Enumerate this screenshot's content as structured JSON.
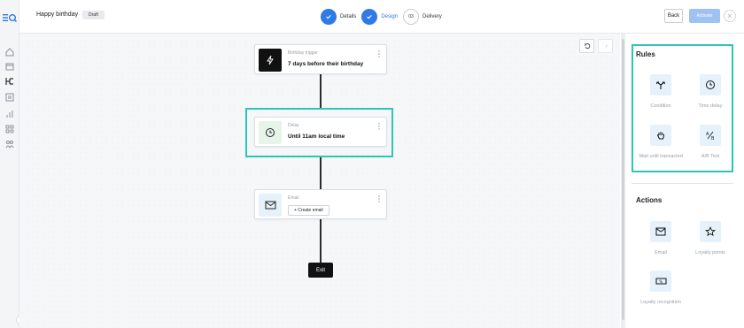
{
  "header": {
    "campaign_title": "Happy birthday",
    "status_badge": "Draft",
    "steps": [
      {
        "label": "Details",
        "state": "done"
      },
      {
        "label": "Design",
        "state": "active"
      },
      {
        "number": "03",
        "label": "Delivery",
        "state": "todo"
      }
    ],
    "back_label": "Back",
    "activate_label": "Activate"
  },
  "canvas": {
    "nodes": [
      {
        "type_label": "Birthday trigger",
        "main_label": "7 days before their birthday",
        "icon": "lightning-icon"
      },
      {
        "type_label": "Delay",
        "main_label": "Until 11am local time",
        "icon": "clock-icon"
      },
      {
        "type_label": "Email",
        "button_label": "+ Create email",
        "icon": "envelope-icon"
      }
    ],
    "exit_label": "Exit"
  },
  "panel": {
    "rules_title": "Rules",
    "rules": [
      {
        "label": "Condition",
        "icon": "branch-icon"
      },
      {
        "label": "Time delay",
        "icon": "clock-icon"
      },
      {
        "label": "Wait until transacted",
        "icon": "hand-icon"
      },
      {
        "label": "A/B Test",
        "icon": "ab-test-icon"
      }
    ],
    "actions_title": "Actions",
    "actions": [
      {
        "label": "Email",
        "icon": "envelope-icon"
      },
      {
        "label": "Loyalty points",
        "icon": "star-icon"
      },
      {
        "label": "Loyalty recognition",
        "icon": "ticket-icon"
      }
    ]
  },
  "colors": {
    "accent_blue": "#2e7be6",
    "highlight_teal": "#2ec4b6",
    "tile_bg": "#e6f2fb"
  }
}
